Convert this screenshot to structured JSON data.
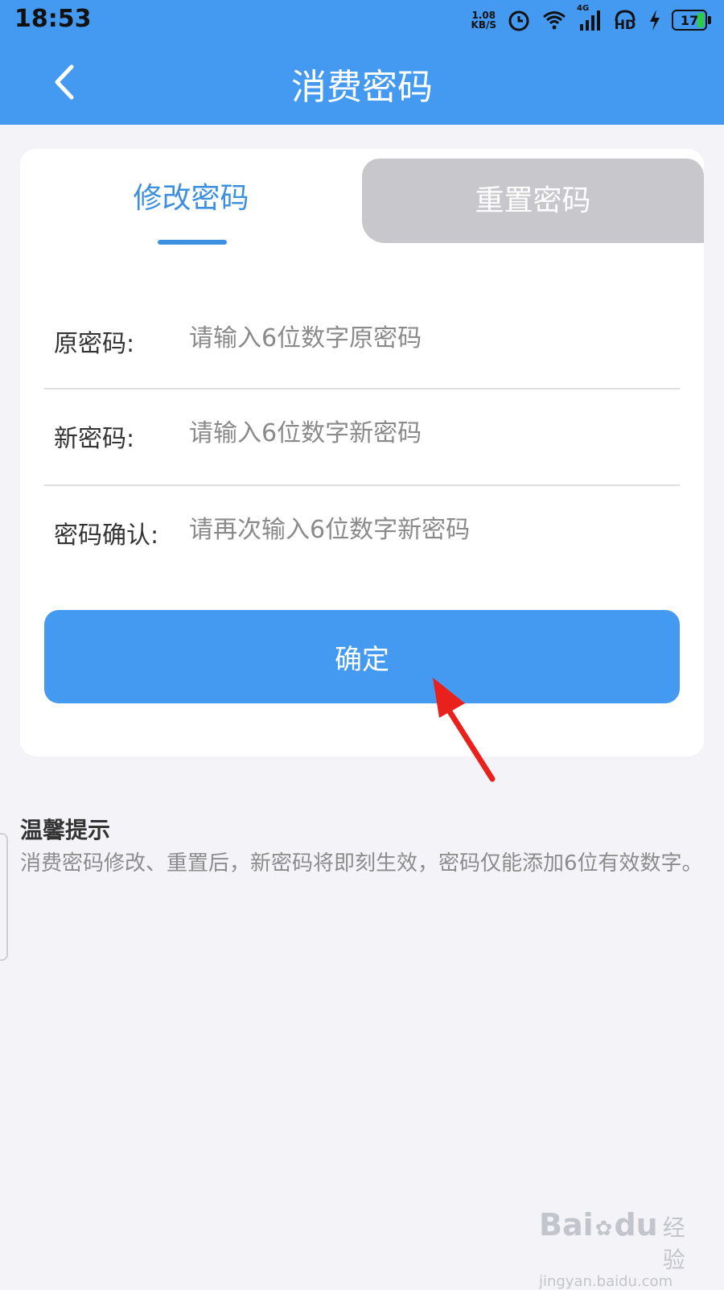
{
  "status_bar": {
    "time": "18:53",
    "net_speed_value": "1.08",
    "net_speed_unit": "KB/S",
    "network_type": "4G",
    "hd_label": "HD",
    "battery_level": "17"
  },
  "header": {
    "title": "消费密码"
  },
  "tabs": [
    {
      "label": "修改密码",
      "active": true
    },
    {
      "label": "重置密码",
      "active": false
    }
  ],
  "form": {
    "fields": [
      {
        "label": "原密码:",
        "placeholder": "请输入6位数字原密码"
      },
      {
        "label": "新密码:",
        "placeholder": "请输入6位数字新密码"
      },
      {
        "label": "密码确认:",
        "placeholder": "请再次输入6位数字新密码"
      }
    ],
    "submit_label": "确定"
  },
  "tips": {
    "title": "温馨提示",
    "text": "消费密码修改、重置后，新密码将即刻生效，密码仅能添加6位有效数字。"
  },
  "watermark": {
    "brand_a": "Bai",
    "brand_b": "du",
    "brand_c": "经验",
    "url": "jingyan.baidu.com"
  },
  "colors": {
    "primary": "#4499f0",
    "tab_active_text": "#3d8fe0",
    "tab_inactive_bg": "#c8c7cc",
    "annotation_arrow": "#e8211d"
  }
}
